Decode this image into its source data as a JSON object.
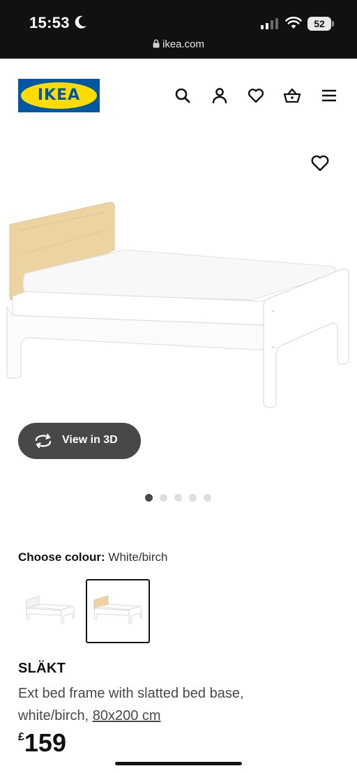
{
  "status_bar": {
    "time": "15:53",
    "battery": "52",
    "url": "ikea.com"
  },
  "header": {
    "logo_text": "IKEA",
    "icons": [
      "search-icon",
      "profile-icon",
      "heart-icon",
      "basket-icon",
      "menu-icon"
    ]
  },
  "gallery": {
    "view_3d_label": "View in 3D",
    "image_count": 5,
    "active_index": 0
  },
  "colour": {
    "label": "Choose colour:",
    "value": "White/birch",
    "options": [
      "White",
      "White/birch"
    ],
    "selected_index": 1
  },
  "product": {
    "name": "SLÄKT",
    "description_line1": "Ext bed frame with slatted bed base,",
    "description_line2": "white/birch, ",
    "size": "80x200 cm",
    "currency": "£",
    "price": "159"
  },
  "colors": {
    "ikea_blue": "#0058a3",
    "ikea_yellow": "#ffdb00",
    "dark_button": "#484848"
  }
}
